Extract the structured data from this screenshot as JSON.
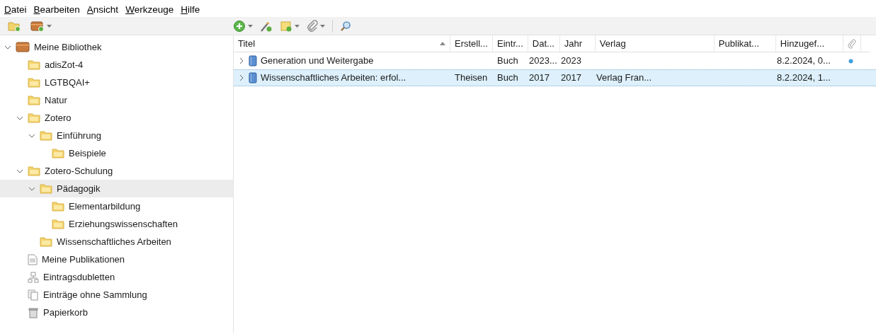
{
  "menu": [
    "Datei",
    "Bearbeiten",
    "Ansicht",
    "Werkzeuge",
    "Hilfe"
  ],
  "toolbar_left": [
    {
      "kind": "new-collection",
      "dropdown": false
    },
    {
      "kind": "library",
      "dropdown": true
    }
  ],
  "toolbar_right": [
    {
      "kind": "add-item",
      "dropdown": true
    },
    {
      "kind": "wand",
      "dropdown": false
    },
    {
      "kind": "note",
      "dropdown": true
    },
    {
      "kind": "attachment",
      "dropdown": true
    },
    {
      "kind": "separator"
    },
    {
      "kind": "search",
      "dropdown": false
    }
  ],
  "tree": [
    {
      "label": "Meine Bibliothek",
      "kind": "library",
      "expanded": true,
      "selected": false,
      "children": [
        {
          "label": "adisZot-4",
          "kind": "folder",
          "selected": false
        },
        {
          "label": "LGTBQAI+",
          "kind": "folder",
          "selected": false
        },
        {
          "label": "Natur",
          "kind": "folder",
          "selected": false
        },
        {
          "label": "Zotero",
          "kind": "folder",
          "expanded": true,
          "selected": false,
          "children": [
            {
              "label": "Einführung",
              "kind": "folder",
              "expanded": true,
              "selected": false,
              "children": [
                {
                  "label": "Beispiele",
                  "kind": "folder",
                  "selected": false
                }
              ]
            }
          ]
        },
        {
          "label": "Zotero-Schulung",
          "kind": "folder",
          "expanded": true,
          "selected": false,
          "children": [
            {
              "label": "Pädagogik",
              "kind": "folder",
              "expanded": true,
              "selected": true,
              "children": [
                {
                  "label": "Elementarbildung",
                  "kind": "folder",
                  "selected": false
                },
                {
                  "label": "Erziehungswissenschaften",
                  "kind": "folder",
                  "selected": false
                }
              ]
            },
            {
              "label": "Wissenschaftliches Arbeiten",
              "kind": "folder",
              "selected": false
            }
          ]
        },
        {
          "label": "Meine Publikationen",
          "kind": "publications",
          "selected": false
        },
        {
          "label": "Eintragsdubletten",
          "kind": "duplicates",
          "selected": false
        },
        {
          "label": "Einträge ohne Sammlung",
          "kind": "unfiled",
          "selected": false
        },
        {
          "label": "Papierkorb",
          "kind": "trash",
          "selected": false
        }
      ]
    }
  ],
  "table": {
    "columns": [
      {
        "label": "Titel",
        "sorted": true
      },
      {
        "label": "Erstell...",
        "sorted": false
      },
      {
        "label": "Eintr...",
        "sorted": false
      },
      {
        "label": "Dat...",
        "sorted": false
      },
      {
        "label": "Jahr",
        "sorted": false
      },
      {
        "label": "Verlag",
        "sorted": false
      },
      {
        "label": "Publikat...",
        "sorted": false
      },
      {
        "label": "Hinzugef...",
        "sorted": false
      }
    ],
    "rows": [
      {
        "cells": [
          "Generation und Weitergabe",
          "",
          "Buch",
          "2023...",
          "2023",
          "",
          "",
          "8.2.2024, 0..."
        ],
        "selected": false,
        "unread": true
      },
      {
        "cells": [
          "Wissenschaftliches Arbeiten: erfol...",
          "Theisen",
          "Buch",
          "2017",
          "2017",
          "Verlag Fran...",
          "",
          "8.2.2024, 1..."
        ],
        "selected": true,
        "unread": false
      }
    ]
  }
}
